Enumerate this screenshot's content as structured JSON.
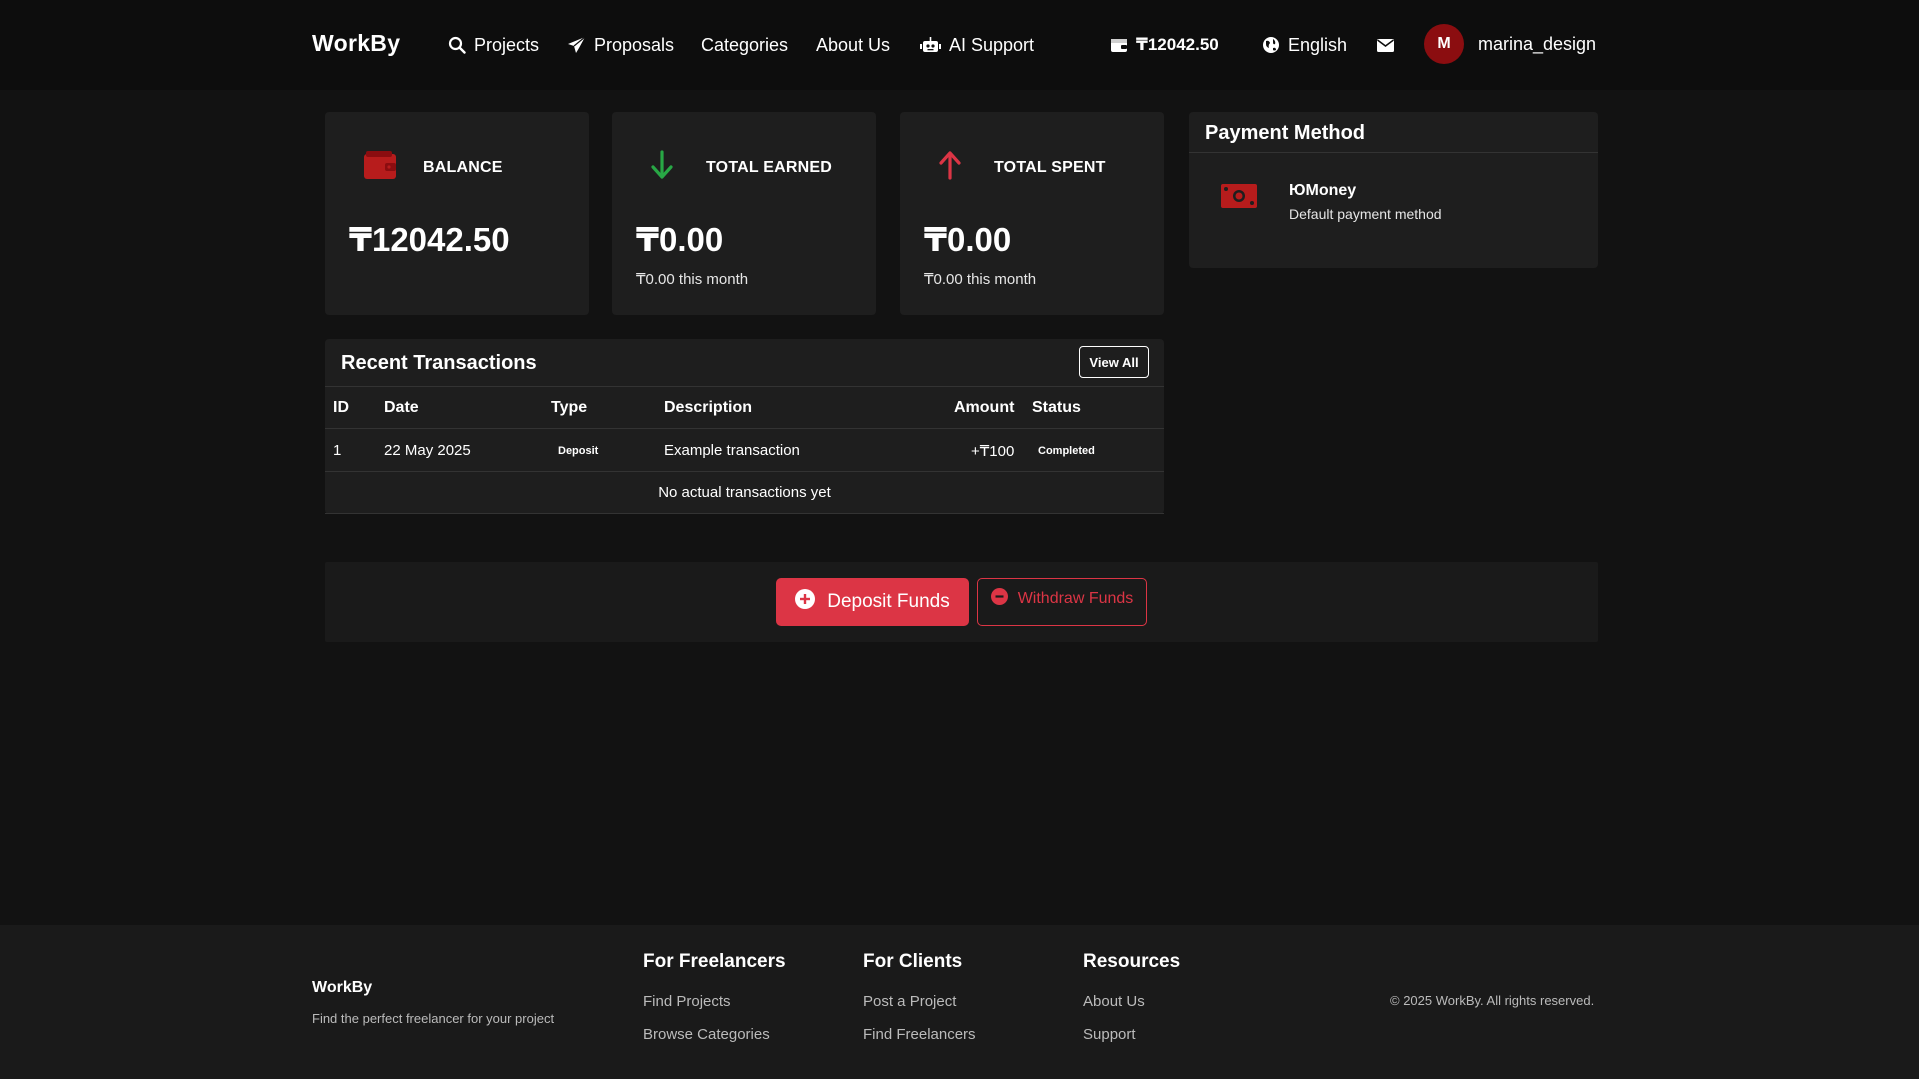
{
  "header": {
    "brand": "WorkBy",
    "nav": [
      {
        "label": "Projects",
        "icon": "search-icon"
      },
      {
        "label": "Proposals",
        "icon": "paper-plane-icon"
      },
      {
        "label": "Categories"
      },
      {
        "label": "About Us"
      },
      {
        "label": "AI Support",
        "icon": "robot-icon"
      }
    ],
    "balance": "₸12042.50",
    "language": "English",
    "user": {
      "initial": "M",
      "name": "marina_design"
    }
  },
  "stats": [
    {
      "label": "BALANCE",
      "value": "₸12042.50",
      "sub": "",
      "icon": "wallet-icon",
      "color": "#b71c1c"
    },
    {
      "label": "TOTAL EARNED",
      "value": "₸0.00",
      "sub": "₸0.00 this month",
      "icon": "arrow-down-icon",
      "color": "#28a745"
    },
    {
      "label": "TOTAL SPENT",
      "value": "₸0.00",
      "sub": "₸0.00 this month",
      "icon": "arrow-up-icon",
      "color": "#dc3545"
    }
  ],
  "payment_method": {
    "title": "Payment Method",
    "name": "ЮMoney",
    "description": "Default payment method",
    "icon": "money-bill-icon"
  },
  "transactions": {
    "title": "Recent Transactions",
    "view_all": "View All",
    "columns": [
      "ID",
      "Date",
      "Type",
      "Description",
      "Amount",
      "Status"
    ],
    "rows": [
      {
        "id": "1",
        "date": "22 May 2025",
        "type": "Deposit",
        "description": "Example transaction",
        "amount": "+₸100",
        "status": "Completed"
      }
    ],
    "empty_message": "No actual transactions yet"
  },
  "actions": {
    "deposit": "Deposit Funds",
    "withdraw": "Withdraw Funds"
  },
  "footer": {
    "brand": "WorkBy",
    "tagline": "Find the perfect freelancer for your project",
    "columns": [
      {
        "title": "For Freelancers",
        "links": [
          "Find Projects",
          "Browse Categories"
        ]
      },
      {
        "title": "For Clients",
        "links": [
          "Post a Project",
          "Find Freelancers"
        ]
      },
      {
        "title": "Resources",
        "links": [
          "About Us",
          "Support"
        ]
      }
    ],
    "copyright": "© 2025 WorkBy. All rights reserved."
  },
  "colors": {
    "accent": "#dc3545",
    "success": "#28a745",
    "background": "#121212",
    "card": "#1e1e1e"
  }
}
